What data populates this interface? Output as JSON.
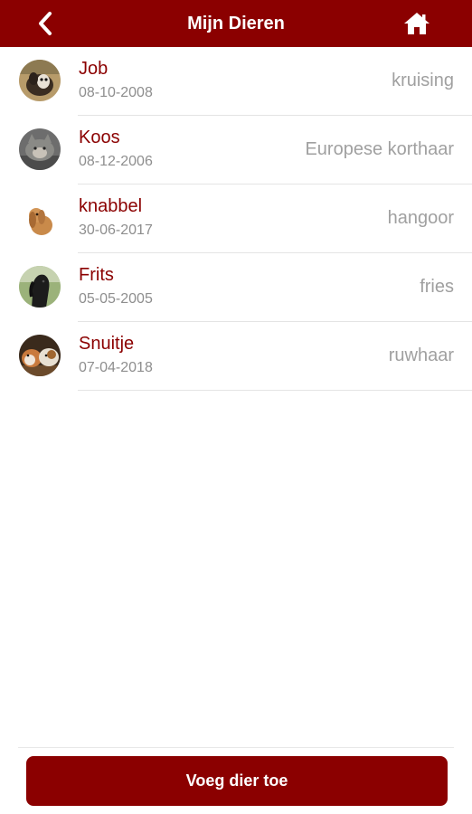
{
  "header": {
    "title": "Mijn Dieren",
    "back_icon": "chevron-left-icon",
    "home_icon": "home-icon",
    "background_color": "#8b0000"
  },
  "pets": [
    {
      "name": "Job",
      "date": "08-10-2008",
      "breed": "kruising",
      "avatar": "dog-photo"
    },
    {
      "name": "Koos",
      "date": "08-12-2006",
      "breed": "Europese korthaar",
      "avatar": "cat-photo"
    },
    {
      "name": "knabbel",
      "date": "30-06-2017",
      "breed": "hangoor",
      "avatar": "rabbit-photo"
    },
    {
      "name": "Frits",
      "date": "05-05-2005",
      "breed": "fries",
      "avatar": "horse-photo"
    },
    {
      "name": "Snuitje",
      "date": "07-04-2018",
      "breed": "ruwhaar",
      "avatar": "guinea-pig-photo"
    }
  ],
  "footer": {
    "add_button_label": "Voeg dier toe"
  },
  "colors": {
    "accent": "#8b0000",
    "secondary_text": "#8e8e8e",
    "breed_text": "#a0a0a0"
  }
}
